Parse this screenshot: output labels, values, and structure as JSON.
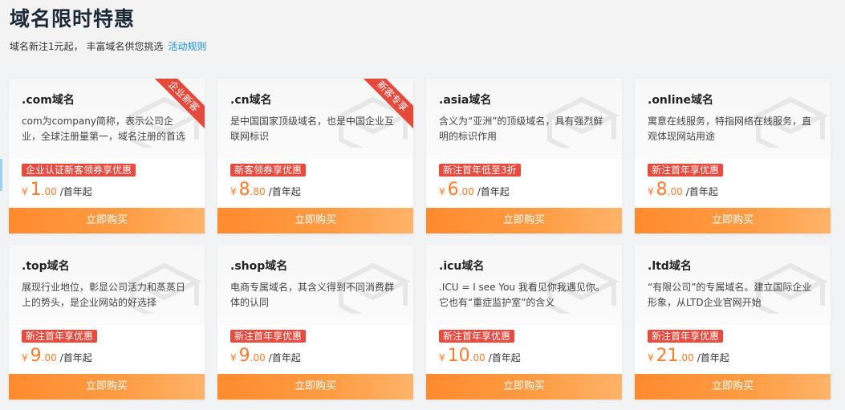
{
  "header": {
    "title": "域名限时特惠",
    "subtitle": "域名新注1元起， 丰富域名供您挑选",
    "rules_link": "活动规则"
  },
  "colors": {
    "accent": "#ff8a2e",
    "promo": "#e84a3f",
    "link": "#1a8fe0"
  },
  "cards": [
    {
      "title": ".com域名",
      "desc": "com为company简称，表示公司企业，全球注册量第一，域名注册的首选",
      "promo": "企业认证新客领券享优惠",
      "yen": "¥",
      "int": "1",
      "dec": ".00",
      "unit": "/首年起",
      "button": "立即购买",
      "ribbon": "企业新客"
    },
    {
      "title": ".cn域名",
      "desc": "是中国国家顶级域名，也是中国企业互联网标识",
      "promo": "新客领券享优惠",
      "yen": "¥",
      "int": "8",
      "dec": ".80",
      "unit": "/首年起",
      "button": "立即购买",
      "ribbon": "新客专享"
    },
    {
      "title": ".asia域名",
      "desc": "含义为“亚洲”的顶级域名，具有强烈鲜明的标识作用",
      "promo": "新注首年低至3折",
      "yen": "¥",
      "int": "6",
      "dec": ".00",
      "unit": "/首年起",
      "button": "立即购买"
    },
    {
      "title": ".online域名",
      "desc": "寓意在线服务，特指网络在线服务，直观体现网站用途",
      "promo": "新注首年享优惠",
      "yen": "¥",
      "int": "8",
      "dec": ".00",
      "unit": "/首年起",
      "button": "立即购买"
    },
    {
      "title": ".top域名",
      "desc": "展现行业地位，彰显公司活力和蒸蒸日上的势头，是企业网站的好选择",
      "promo": "新注首年享优惠",
      "yen": "¥",
      "int": "9",
      "dec": ".00",
      "unit": "/首年起",
      "button": "立即购买"
    },
    {
      "title": ".shop域名",
      "desc": "电商专属域名，其含义得到不同消费群体的认同",
      "promo": "新注首年享优惠",
      "yen": "¥",
      "int": "9",
      "dec": ".00",
      "unit": "/首年起",
      "button": "立即购买"
    },
    {
      "title": ".icu域名",
      "desc": ".ICU = I see You 我看见你我遇见你。它也有“重症监护室”的含义",
      "promo": "新注首年享优惠",
      "yen": "¥",
      "int": "10",
      "dec": ".00",
      "unit": "/首年起",
      "button": "立即购买"
    },
    {
      "title": ".ltd域名",
      "desc": "“有限公司”的专属域名。建立国际企业形象，从LTD企业官网开始",
      "promo": "新注首年享优惠",
      "yen": "¥",
      "int": "21",
      "dec": ".00",
      "unit": "/首年起",
      "button": "立即购买"
    }
  ]
}
